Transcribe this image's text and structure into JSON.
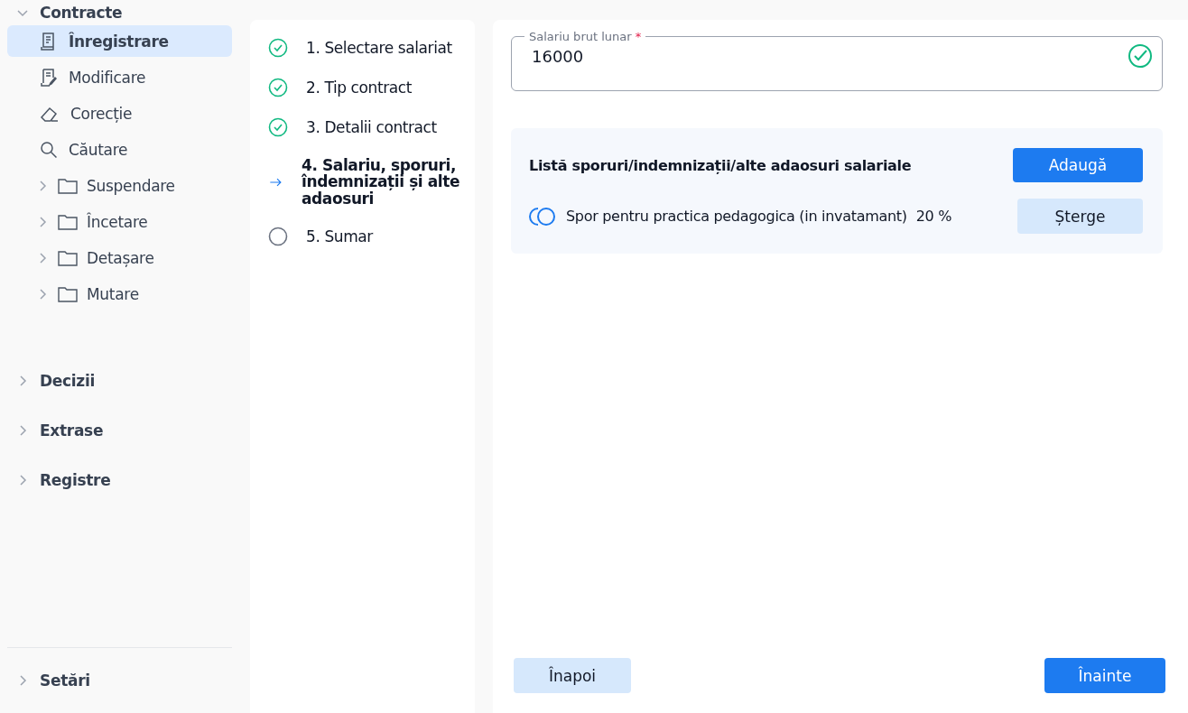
{
  "sidebar": {
    "sections": [
      {
        "label": "Contracte",
        "expanded": true,
        "children": [
          {
            "label": "Înregistrare",
            "kind": "page",
            "selected": true
          },
          {
            "label": "Modificare",
            "kind": "page",
            "selected": false
          },
          {
            "label": "Corecție",
            "kind": "page",
            "selected": false
          },
          {
            "label": "Căutare",
            "kind": "page",
            "selected": false
          },
          {
            "label": "Suspendare",
            "kind": "folder",
            "selected": false,
            "expanded": false
          },
          {
            "label": "Încetare",
            "kind": "folder",
            "selected": false,
            "expanded": false
          },
          {
            "label": "Detașare",
            "kind": "folder",
            "selected": false,
            "expanded": false
          },
          {
            "label": "Mutare",
            "kind": "folder",
            "selected": false,
            "expanded": false
          }
        ]
      },
      {
        "label": "Decizii",
        "expanded": false
      },
      {
        "label": "Extrase",
        "expanded": false
      },
      {
        "label": "Registre",
        "expanded": false
      }
    ],
    "footer": {
      "label": "Setări",
      "expanded": false
    }
  },
  "steps": [
    {
      "label": "1. Selectare salariat",
      "done": true,
      "selected": false
    },
    {
      "label": "2. Tip contract",
      "done": true,
      "selected": false
    },
    {
      "label": "3. Detalii contract",
      "done": true,
      "selected": false
    },
    {
      "label": "4. Salariu, sporuri, îndemnizații și alte adaosuri",
      "done": false,
      "selected": true
    },
    {
      "label": "5. Sumar",
      "done": false,
      "selected": false
    }
  ],
  "salary_field": {
    "label": "Salariu brut lunar",
    "required_mark": "*",
    "value": "16000",
    "valid": true
  },
  "allowances": {
    "title": "Listă sporuri/indemnizații/alte adaosuri salariale",
    "add_button": "Adaugă",
    "items": [
      {
        "name": "Spor pentru practica pedagogica (in invatamant)",
        "value": "20 %",
        "delete_button": "Șterge"
      }
    ]
  },
  "footer": {
    "back_button": "Înapoi",
    "next_button": "Înainte"
  }
}
